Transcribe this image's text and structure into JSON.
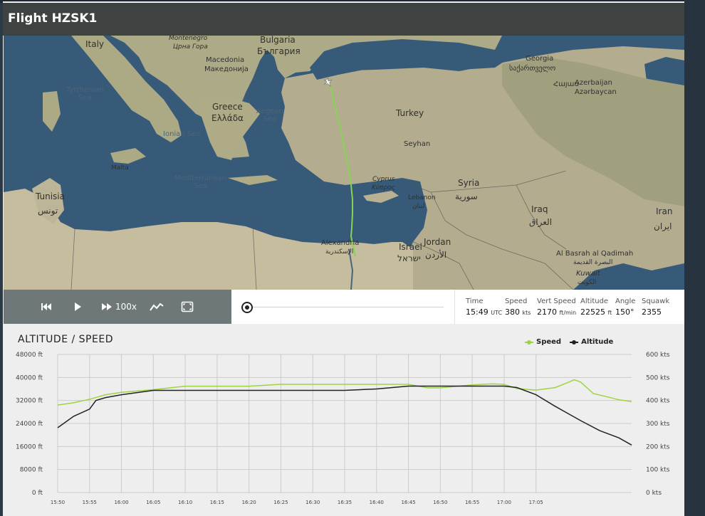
{
  "header": {
    "title": "Flight HZSK1"
  },
  "map": {
    "labels": {
      "italy": "Italy",
      "montenegro": "Montenegro",
      "montenegro_native": "Црна Гора",
      "bulgaria": "Bulgaria",
      "bulgaria_native": "България",
      "macedonia": "Macedonia",
      "macedonia_native": "Македонија",
      "georgia": "Georgia",
      "georgia_native": "საქართველო",
      "tyrrhenian_sea": "Tyrrhenian\nSea",
      "greece": "Greece",
      "greece_native": "Ελλάδα",
      "aegean_sea": "Aegean\nSea",
      "ionian_sea": "Ionian Sea",
      "turkey": "Turkey",
      "armenia_native": "Հայաս",
      "azerbaijan": "Azerbaijan",
      "azerbaijan_native": "Azərbaycan",
      "seyhan": "Seyhan",
      "malta": "Malta",
      "mediterranean_sea": "Mediterranean\nSea",
      "cyprus": "Cyprus",
      "cyprus_native": "Κύπρος",
      "syria": "Syria",
      "syria_native": "سورية",
      "tunisia": "Tunisia",
      "tunisia_native": "تونس",
      "lebanon": "Lebanon",
      "lebanon_native": "لبنان",
      "iraq": "Iraq",
      "iraq_native": "العراق",
      "iran": "Iran",
      "iran_native": "ایران",
      "alexandria": "Alexandria",
      "alexandria_native": "الإسكندرية",
      "jordan": "Jordan",
      "jordan_native": "الأردن",
      "israel": "Israel",
      "israel_native": "ישראל",
      "basrah": "Al Basrah al Qadimah",
      "basrah_native": "البصرة القديمة",
      "kuwait": "Kuwait",
      "kuwait_native": "الكويت"
    },
    "colors": {
      "sea": "#3a5f80",
      "land": "#cfc4a3",
      "green_land": "#a9ad82",
      "track": "#8fe05a"
    }
  },
  "controls": {
    "rewind_icon": "skip-back-icon",
    "play_icon": "play-icon",
    "speed_icon": "fast-forward-icon",
    "speed_label": "100x",
    "graph_icon": "chart-line-icon",
    "fullscreen_icon": "fullscreen-icon"
  },
  "stats": {
    "time": {
      "label": "Time",
      "value": "15:49",
      "unit": "UTC"
    },
    "speed": {
      "label": "Speed",
      "value": "380",
      "unit": "kts"
    },
    "vert_speed": {
      "label": "Vert Speed",
      "value": "2170",
      "unit": "ft/min"
    },
    "altitude": {
      "label": "Altitude",
      "value": "22525",
      "unit": "ft"
    },
    "angle": {
      "label": "Angle",
      "value": "150°"
    },
    "squawk": {
      "label": "Squawk",
      "value": "2355"
    }
  },
  "chart": {
    "title": "ALTITUDE / SPEED",
    "legend": {
      "speed": "Speed",
      "altitude": "Altitude"
    },
    "colors": {
      "speed": "#9dd442",
      "altitude": "#222222",
      "grid": "#cccccc"
    }
  },
  "chart_data": {
    "type": "line",
    "title": "ALTITUDE / SPEED",
    "x": [
      "15:50",
      "15:55",
      "16:00",
      "16:05",
      "16:10",
      "16:15",
      "16:20",
      "16:25",
      "16:30",
      "16:35",
      "16:40",
      "16:45",
      "16:50",
      "16:55",
      "17:00",
      "17:05"
    ],
    "x_minutes": [
      0,
      2.5,
      5,
      7.5,
      10,
      15,
      20,
      25,
      30,
      35,
      40,
      45,
      50,
      55,
      58,
      60,
      62,
      65,
      68,
      70,
      72,
      75
    ],
    "y_left_ticks": [
      "0 ft",
      "8000 ft",
      "16000 ft",
      "24000 ft",
      "32000 ft",
      "40000 ft",
      "48000 ft"
    ],
    "y_right_ticks": [
      "0 kts",
      "100 kts",
      "200 kts",
      "300 kts",
      "400 kts",
      "500 kts",
      "600 kts"
    ],
    "ylim_left": [
      0,
      48000
    ],
    "ylim_right": [
      0,
      600
    ],
    "grid": true,
    "legend_position": "top-right",
    "series": [
      {
        "name": "Speed",
        "axis": "right",
        "points": [
          [
            0,
            380
          ],
          [
            2.5,
            390
          ],
          [
            5,
            405
          ],
          [
            7.5,
            425
          ],
          [
            10,
            435
          ],
          [
            15,
            447
          ],
          [
            20,
            462
          ],
          [
            25,
            462
          ],
          [
            30,
            462
          ],
          [
            35,
            470
          ],
          [
            40,
            470
          ],
          [
            45,
            470
          ],
          [
            50,
            470
          ],
          [
            55,
            470
          ],
          [
            58,
            455
          ],
          [
            60,
            455
          ],
          [
            62,
            460
          ],
          [
            65,
            468
          ],
          [
            68,
            472
          ],
          [
            70,
            470
          ],
          [
            72,
            452
          ],
          [
            75,
            445
          ],
          [
            78,
            456
          ],
          [
            80,
            478
          ],
          [
            81,
            490
          ],
          [
            82,
            480
          ],
          [
            84,
            430
          ],
          [
            86,
            417
          ],
          [
            88,
            403
          ],
          [
            90,
            395
          ]
        ]
      },
      {
        "name": "Altitude",
        "axis": "left",
        "points": [
          [
            0,
            22525
          ],
          [
            2.5,
            26500
          ],
          [
            5,
            29000
          ],
          [
            6,
            32000
          ],
          [
            7.5,
            33000
          ],
          [
            10,
            34000
          ],
          [
            15,
            35500
          ],
          [
            20,
            35500
          ],
          [
            25,
            35500
          ],
          [
            30,
            35500
          ],
          [
            35,
            35500
          ],
          [
            40,
            35500
          ],
          [
            45,
            35500
          ],
          [
            50,
            36000
          ],
          [
            55,
            37000
          ],
          [
            60,
            37000
          ],
          [
            65,
            37000
          ],
          [
            70,
            37000
          ],
          [
            72,
            36500
          ],
          [
            75,
            34000
          ],
          [
            78,
            30000
          ],
          [
            80,
            27500
          ],
          [
            82,
            25000
          ],
          [
            85,
            21500
          ],
          [
            88,
            19000
          ],
          [
            90,
            16500
          ]
        ]
      }
    ]
  }
}
